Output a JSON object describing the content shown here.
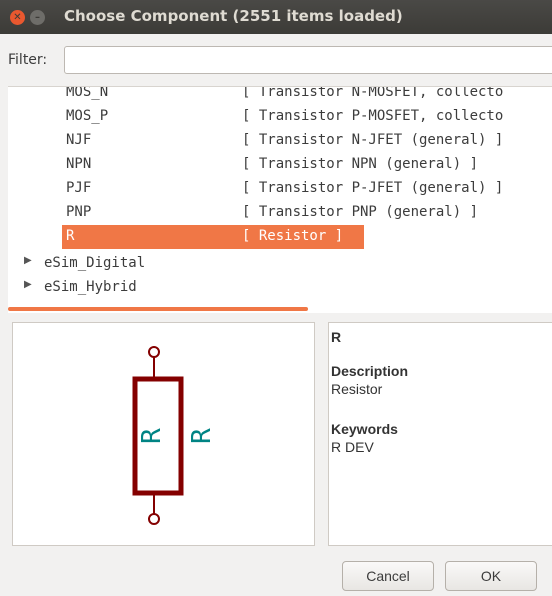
{
  "window": {
    "title": "Choose Component (2551 items loaded)"
  },
  "filter": {
    "label": "Filter:",
    "value": ""
  },
  "components": [
    {
      "name": "MOS_N",
      "desc": "[ Transistor N-MOSFET, collecto"
    },
    {
      "name": "MOS_P",
      "desc": "[ Transistor P-MOSFET, collecto"
    },
    {
      "name": "NJF",
      "desc": "[ Transistor N-JFET (general) ]"
    },
    {
      "name": "NPN",
      "desc": "[ Transistor NPN (general) ]"
    },
    {
      "name": "PJF",
      "desc": "[ Transistor P-JFET (general) ]"
    },
    {
      "name": "PNP",
      "desc": "[ Transistor PNP (general) ]"
    },
    {
      "name": "R",
      "desc": "[ Resistor ]",
      "selected": true
    }
  ],
  "groups": [
    {
      "name": "eSim_Digital",
      "icon": "expand-arrow-icon"
    },
    {
      "name": "eSim_Hybrid",
      "icon": "expand-arrow-icon"
    }
  ],
  "preview": {
    "ref": "R",
    "value": "R",
    "body_color": "#840000",
    "text_color": "#008484"
  },
  "info": {
    "name": "R",
    "description_heading": "Description",
    "description": "Resistor",
    "keywords_heading": "Keywords",
    "keywords": "R DEV"
  },
  "buttons": {
    "cancel": "Cancel",
    "ok": "OK"
  },
  "colors": {
    "accent": "#f07746",
    "titlebar": "#3c3b37",
    "close": "#e9582f"
  }
}
